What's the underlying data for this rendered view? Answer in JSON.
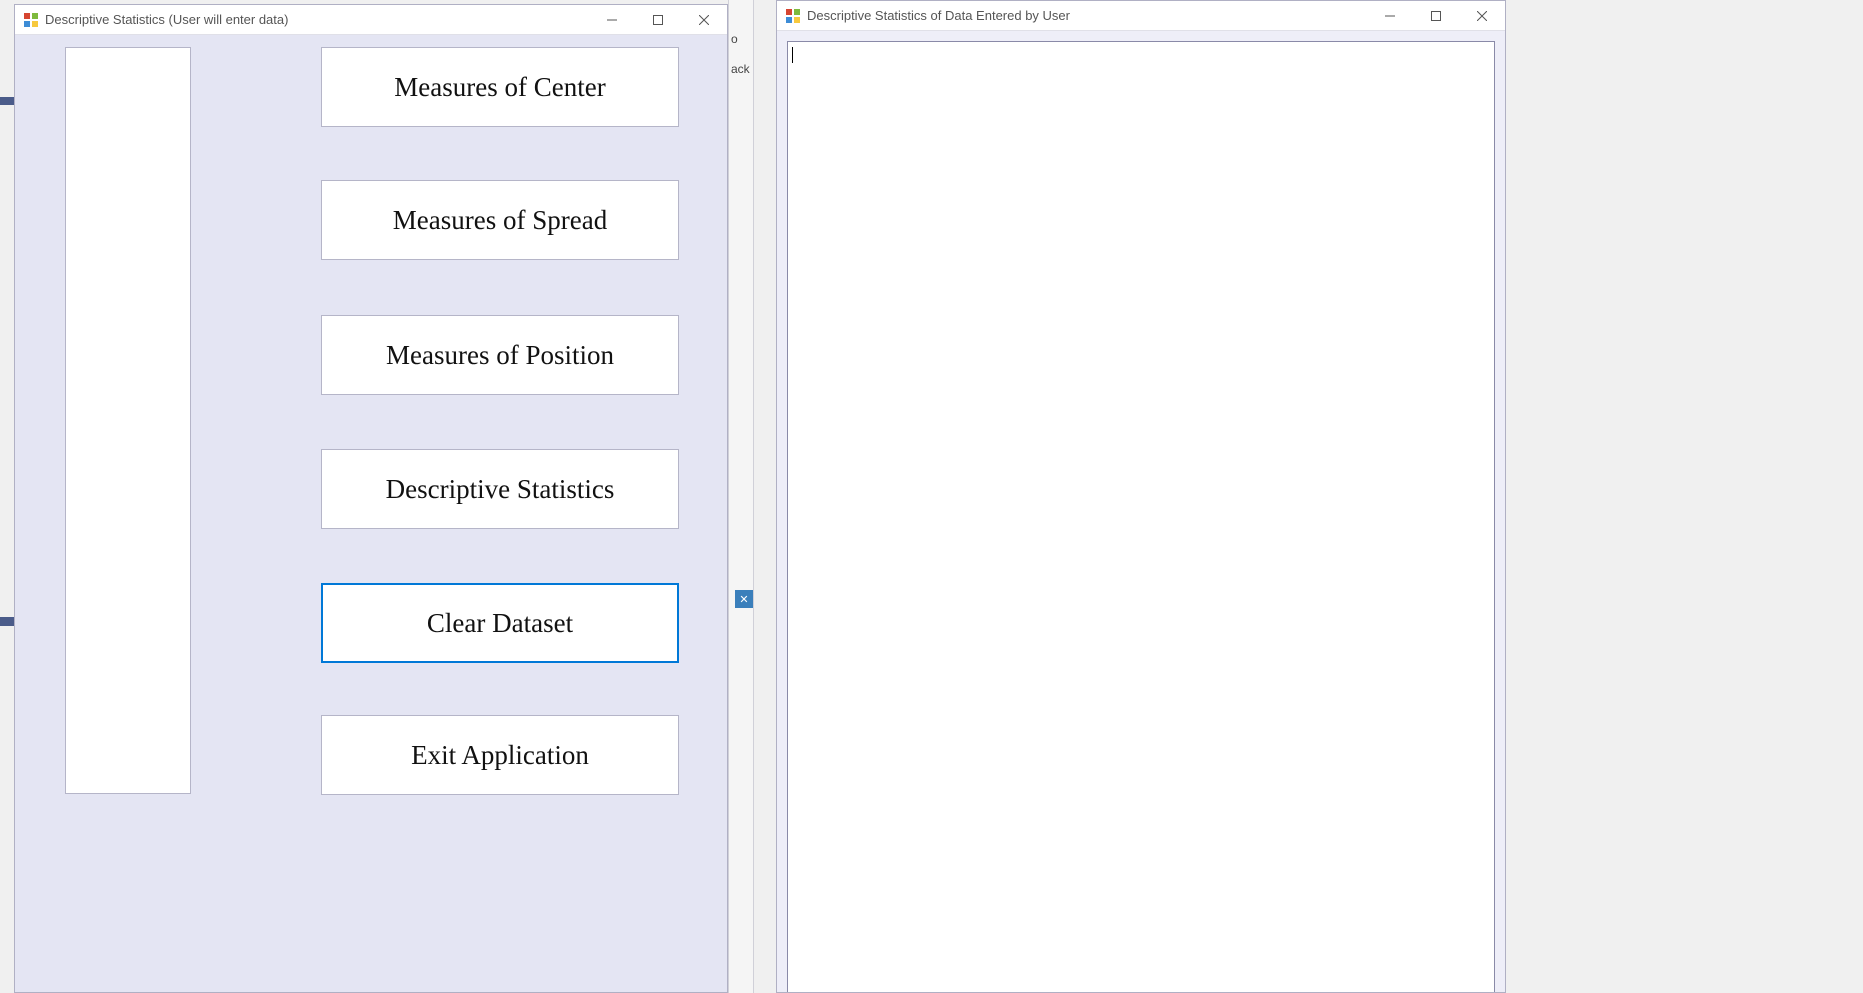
{
  "windows": {
    "left": {
      "title": "Descriptive Statistics (User will enter data)",
      "buttons": {
        "measures_center": "Measures of Center",
        "measures_spread": "Measures of Spread",
        "measures_position": "Measures of Position",
        "descriptive_stats": "Descriptive Statistics",
        "clear_dataset": "Clear Dataset",
        "exit_application": "Exit Application"
      },
      "listbox_value": ""
    },
    "right": {
      "title": "Descriptive Statistics of Data Entered by User",
      "output_value": ""
    }
  },
  "background_fragments": {
    "gutter_top": "o",
    "gutter_text": "ack"
  }
}
